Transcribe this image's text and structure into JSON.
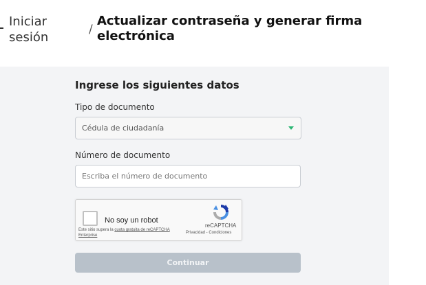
{
  "breadcrumb": {
    "link_label": "Iniciar sesión",
    "separator": "/",
    "current": "Actualizar contraseña y generar firma electrónica"
  },
  "form": {
    "heading": "Ingrese los siguientes datos",
    "doc_type": {
      "label": "Tipo de documento",
      "selected": "Cédula de ciudadanía"
    },
    "doc_number": {
      "label": "Número de documento",
      "placeholder": "Escriba el número de documento",
      "value": ""
    },
    "captcha": {
      "label": "No soy un robot",
      "brand": "reCAPTCHA",
      "terms": "Privacidad - Condiciones",
      "note_prefix": "Este sitio supera la ",
      "note_link": "cuota gratuita de reCAPTCHA Enterprise"
    },
    "submit_label": "Continuar"
  },
  "colors": {
    "panel_bg": "#f3f4f6",
    "accent_arrow": "#2bb673",
    "button_disabled": "#b8c1ca"
  }
}
